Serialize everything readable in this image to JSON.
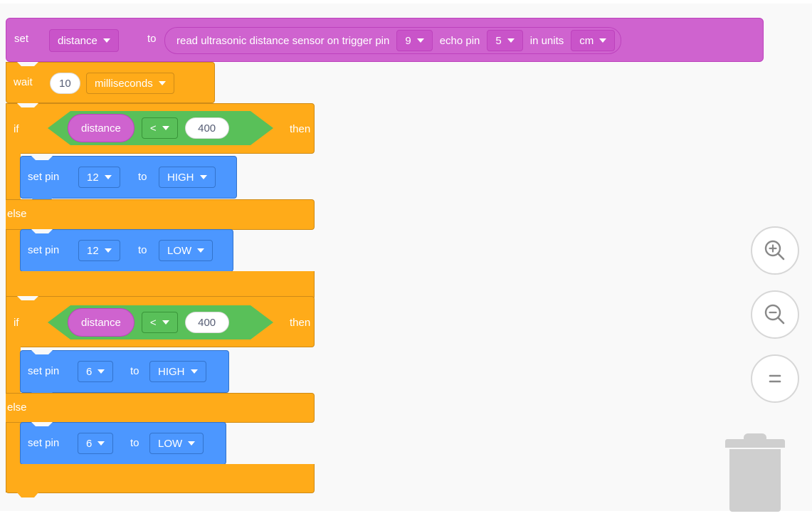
{
  "set_block": {
    "label": "set",
    "variable": "distance",
    "to": "to",
    "sensor_text": "read ultrasonic distance sensor on trigger pin",
    "trigger_pin": "9",
    "echo_label": "echo pin",
    "echo_pin": "5",
    "units_label": "in units",
    "units": "cm"
  },
  "wait_block": {
    "label": "wait",
    "value": "10",
    "unit": "milliseconds"
  },
  "if_blocks": [
    {
      "if_label": "if",
      "variable": "distance",
      "operator": "<",
      "value": "400",
      "then_label": "then",
      "else_label": "else",
      "then_action": {
        "label": "set pin",
        "pin": "12",
        "to": "to",
        "state": "HIGH"
      },
      "else_action": {
        "label": "set pin",
        "pin": "12",
        "to": "to",
        "state": "LOW"
      }
    },
    {
      "if_label": "if",
      "variable": "distance",
      "operator": "<",
      "value": "400",
      "then_label": "then",
      "else_label": "else",
      "then_action": {
        "label": "set pin",
        "pin": "6",
        "to": "to",
        "state": "HIGH"
      },
      "else_action": {
        "label": "set pin",
        "pin": "6",
        "to": "to",
        "state": "LOW"
      }
    }
  ],
  "controls": {
    "zoom_in": "zoom-in-icon",
    "zoom_out": "zoom-out-icon",
    "reset": "equals-icon",
    "trash": "trash-icon"
  },
  "colors": {
    "looks": "#cf63cf",
    "control": "#ffab19",
    "operators": "#59c059",
    "pins": "#4c97ff",
    "canvas": "#f9f9f9"
  }
}
